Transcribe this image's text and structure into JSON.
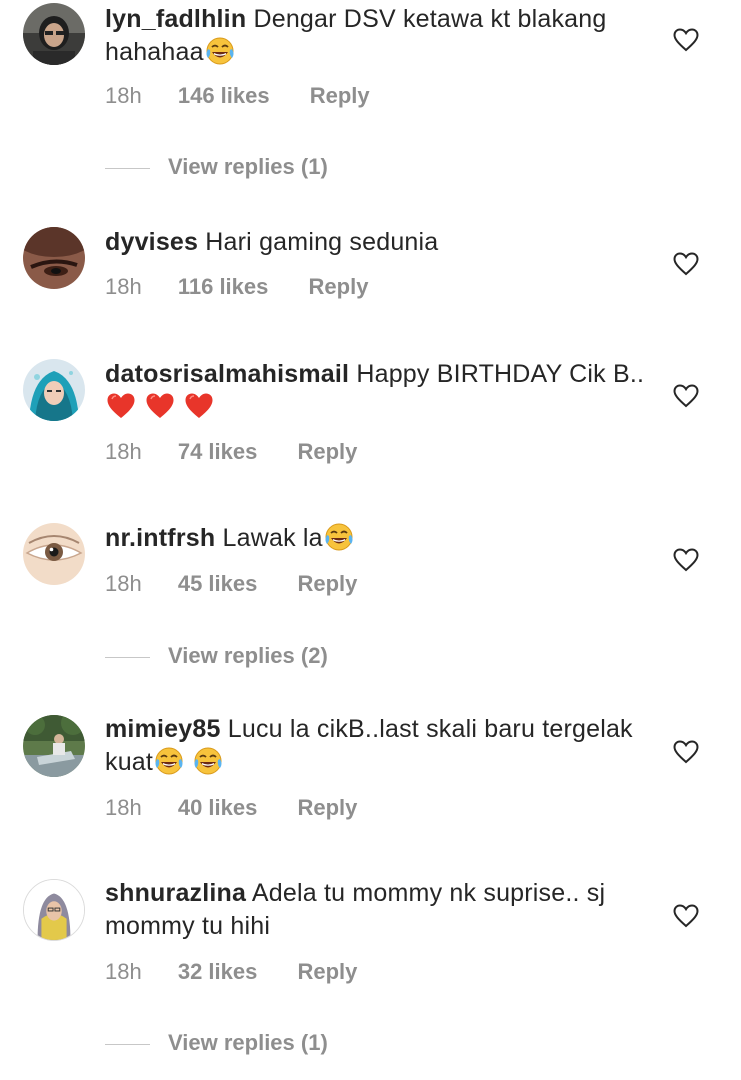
{
  "comments": [
    {
      "username": "lyn_fadlhlin",
      "text": "Dengar DSV ketawa kt blakang hahahaa",
      "emojis": [
        "joy"
      ],
      "time": "18h",
      "likes": "146 likes",
      "reply_label": "Reply",
      "view_replies": "View replies (1)"
    },
    {
      "username": "dyvises",
      "text": "Hari gaming sedunia",
      "emojis": [],
      "time": "18h",
      "likes": "116 likes",
      "reply_label": "Reply"
    },
    {
      "username": "datosrisalmahismail",
      "text": "Happy BIRTHDAY Cik B..",
      "emojis": [
        "red-heart",
        "red-heart",
        "red-heart"
      ],
      "time": "18h",
      "likes": "74 likes",
      "reply_label": "Reply"
    },
    {
      "username": "nr.intfrsh",
      "text": "Lawak la",
      "emojis": [
        "joy"
      ],
      "time": "18h",
      "likes": "45 likes",
      "reply_label": "Reply",
      "view_replies": "View replies (2)"
    },
    {
      "username": "mimiey85",
      "text": "Lucu la cikB..last skali baru tergelak kuat",
      "emojis": [
        "joy",
        "joy"
      ],
      "time": "18h",
      "likes": "40 likes",
      "reply_label": "Reply"
    },
    {
      "username": "shnurazlina",
      "text": "Adela tu mommy nk suprise.. sj mommy tu hihi",
      "emojis": [],
      "time": "18h",
      "likes": "32 likes",
      "reply_label": "Reply",
      "view_replies": "View replies (1)"
    }
  ],
  "icons": {
    "like": "heart-outline-icon",
    "emoji_joy": "face-with-tears-of-joy",
    "emoji_heart": "red-heart"
  },
  "colors": {
    "text": "#262626",
    "secondary": "#8e8e8e",
    "heart_emoji": "#e8352a",
    "joy_emoji": "#f7c33c"
  }
}
